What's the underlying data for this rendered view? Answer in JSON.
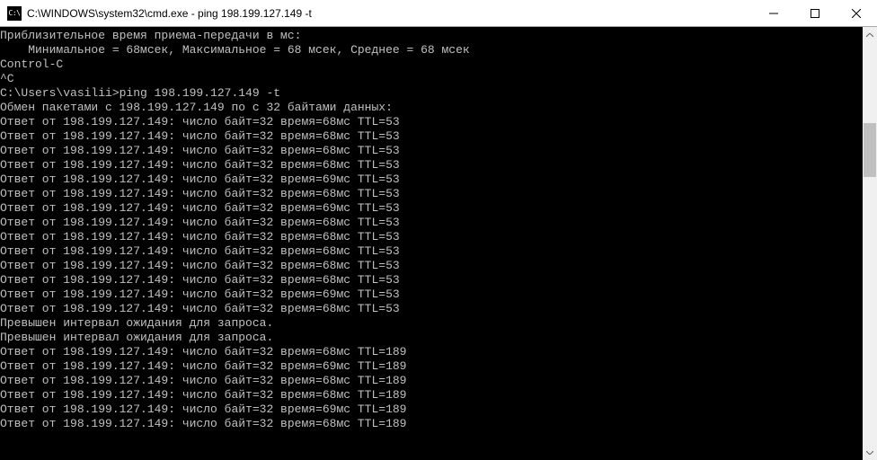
{
  "window": {
    "icon_text": "C:\\",
    "title": "C:\\WINDOWS\\system32\\cmd.exe - ping  198.199.127.149 -t"
  },
  "terminal": {
    "lines": [
      "Приблизительное время приема-передачи в мс:",
      "    Минимальное = 68мсек, Максимальное = 68 мсек, Среднее = 68 мсек",
      "Control-C",
      "^C",
      "C:\\Users\\vasilii>ping 198.199.127.149 -t",
      "",
      "Обмен пакетами с 198.199.127.149 по с 32 байтами данных:",
      "Ответ от 198.199.127.149: число байт=32 время=68мс TTL=53",
      "Ответ от 198.199.127.149: число байт=32 время=68мс TTL=53",
      "Ответ от 198.199.127.149: число байт=32 время=68мс TTL=53",
      "Ответ от 198.199.127.149: число байт=32 время=68мс TTL=53",
      "Ответ от 198.199.127.149: число байт=32 время=69мс TTL=53",
      "Ответ от 198.199.127.149: число байт=32 время=68мс TTL=53",
      "Ответ от 198.199.127.149: число байт=32 время=69мс TTL=53",
      "Ответ от 198.199.127.149: число байт=32 время=68мс TTL=53",
      "Ответ от 198.199.127.149: число байт=32 время=68мс TTL=53",
      "Ответ от 198.199.127.149: число байт=32 время=68мс TTL=53",
      "Ответ от 198.199.127.149: число байт=32 время=68мс TTL=53",
      "Ответ от 198.199.127.149: число байт=32 время=68мс TTL=53",
      "Ответ от 198.199.127.149: число байт=32 время=69мс TTL=53",
      "Ответ от 198.199.127.149: число байт=32 время=68мс TTL=53",
      "Превышен интервал ожидания для запроса.",
      "Превышен интервал ожидания для запроса.",
      "Ответ от 198.199.127.149: число байт=32 время=68мс TTL=189",
      "Ответ от 198.199.127.149: число байт=32 время=69мс TTL=189",
      "Ответ от 198.199.127.149: число байт=32 время=68мс TTL=189",
      "Ответ от 198.199.127.149: число байт=32 время=68мс TTL=189",
      "Ответ от 198.199.127.149: число байт=32 время=69мс TTL=189",
      "Ответ от 198.199.127.149: число байт=32 время=68мс TTL=189"
    ]
  }
}
